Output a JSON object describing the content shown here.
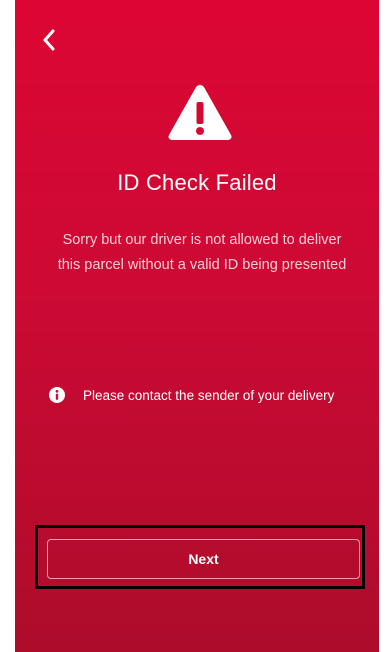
{
  "header": {
    "back_icon": "chevron-left-icon"
  },
  "status": {
    "icon": "warning-triangle-icon",
    "title": "ID Check Failed",
    "message": "Sorry but our driver is not allowed to deliver this parcel without a valid ID being presented"
  },
  "info": {
    "icon": "info-circle-icon",
    "text": "Please contact the sender of your delivery"
  },
  "actions": {
    "next_label": "Next"
  },
  "colors": {
    "background_top": "#dc0633",
    "background_bottom": "#ad0c2b",
    "text": "#ffffff"
  }
}
